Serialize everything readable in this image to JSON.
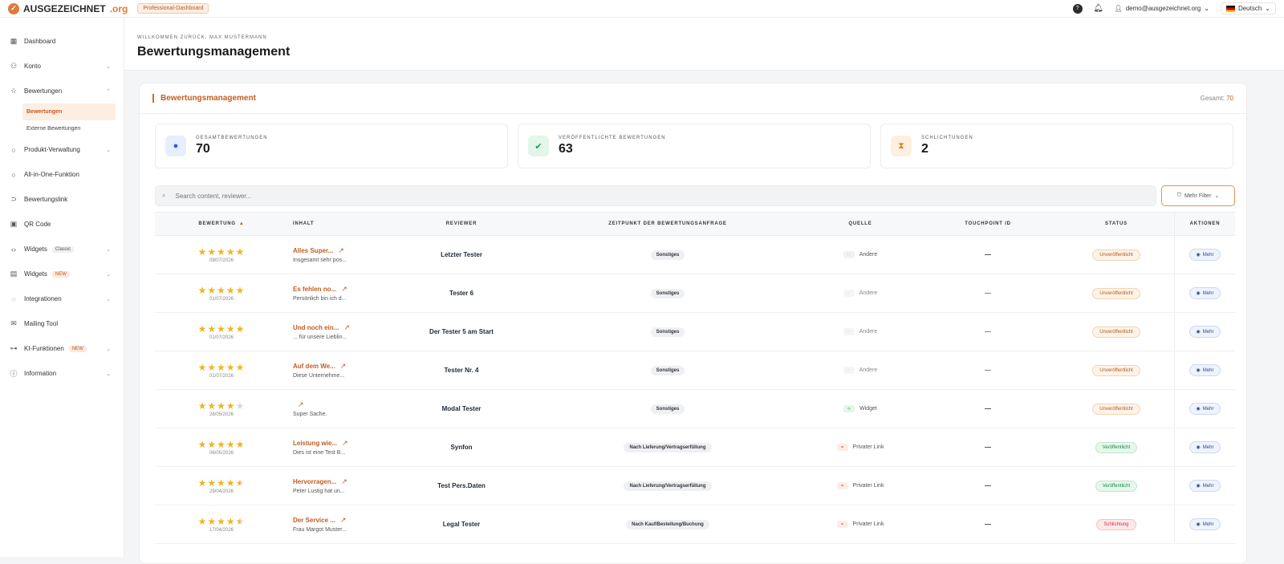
{
  "topbar": {
    "brand": "AUSGEZEICHNET",
    "brand_tld": ".org",
    "plan": "Professional-Dashboard",
    "user_email": "demo@ausgezeichnet.org",
    "language": "Deutsch"
  },
  "sidebar": {
    "items": [
      {
        "label": "Dashboard",
        "icon": "grid-icon"
      },
      {
        "label": "Konto",
        "icon": "user-icon",
        "chevron": true
      },
      {
        "label": "Bewertungen",
        "icon": "star-icon",
        "chevron": true,
        "expanded": true
      },
      {
        "label": "Produkt-Verwaltung",
        "icon": "circle-icon",
        "chevron": true
      },
      {
        "label": "All-in-One-Funktion",
        "icon": "circle-icon"
      },
      {
        "label": "Bewertungslink",
        "icon": "link-icon"
      },
      {
        "label": "QR Code",
        "icon": "qr-icon"
      },
      {
        "label": "Widgets",
        "icon": "code-icon",
        "badge": "Classic",
        "chevron": true
      },
      {
        "label": "Widgets",
        "icon": "widget-icon",
        "badge": "NEW",
        "chevron": true
      },
      {
        "label": "Integrationen",
        "icon": "loader-icon",
        "chevron": true
      },
      {
        "label": "Mailing Tool",
        "icon": "mail-icon"
      },
      {
        "label": "KI-Funktionen",
        "icon": "ai-icon",
        "badge": "NEW",
        "chevron": true
      },
      {
        "label": "Information",
        "icon": "info-icon",
        "chevron": true
      }
    ],
    "sub_items": [
      "Bewertungen",
      "Externe Bewertungen"
    ]
  },
  "header": {
    "welcome": "Willkommen zurück, Max Mustermann",
    "title": "Bewertungsmanagement"
  },
  "card": {
    "title": "Bewertungsmanagement",
    "total_label": "Gesamt:",
    "total_value": "70"
  },
  "stats": [
    {
      "label": "Gesamtbewertungen",
      "value": "70",
      "icon": "chat-bubbles-icon"
    },
    {
      "label": "Veröffentlichte Bewertungen",
      "value": "63",
      "icon": "check-circle-icon"
    },
    {
      "label": "Schlichtungen",
      "value": "2",
      "icon": "hourglass-icon"
    }
  ],
  "filters": {
    "search_placeholder": "Search content, reviewer...",
    "more_filters": "Mehr Filter"
  },
  "table": {
    "headers": [
      "Bewertung",
      "Inhalt",
      "Reviewer",
      "Zeitpunkt der Bewertungsanfrage",
      "Quelle",
      "Touchpoint ID",
      "Status",
      "Aktionen"
    ],
    "more_label": "Mehr",
    "rows": [
      {
        "rating": 5,
        "date": "09/07/2026",
        "title": "Alles Super...",
        "excerpt": "Insgesamt sehr pos...",
        "reviewer": "Letzter Tester",
        "time": "Sonstiges",
        "source": "Andere",
        "touchpoint": "—",
        "status": "Unveröffentlicht",
        "status_type": "unv"
      },
      {
        "rating": 5,
        "date": "01/07/2026",
        "title": "Es fehlen no...",
        "excerpt": "Persönlich bin ich d...",
        "reviewer": "Tester 6",
        "time": "Sonstiges",
        "source": "Andere",
        "touchpoint": "—",
        "status": "Unveröffentlicht",
        "status_type": "unv"
      },
      {
        "rating": 5,
        "date": "01/07/2026",
        "title": "Und noch ein...",
        "excerpt": "... für unsere Lieblin...",
        "reviewer": "Der Tester 5 am Start",
        "time": "Sonstiges",
        "source": "Andere",
        "touchpoint": "—",
        "status": "Unveröffentlicht",
        "status_type": "unv"
      },
      {
        "rating": 5,
        "date": "01/07/2026",
        "title": "Auf dem We...",
        "excerpt": "Diese Unternehme...",
        "reviewer": "Tester Nr. 4",
        "time": "Sonstiges",
        "source": "Andere",
        "touchpoint": "—",
        "status": "Unveröffentlicht",
        "status_type": "unv"
      },
      {
        "rating": 4,
        "date": "26/05/2026",
        "title": "",
        "excerpt": "Super Sache.",
        "reviewer": "Modal Tester",
        "time": "Sonstiges",
        "source": "Widget",
        "touchpoint": "—",
        "status": "Unveröffentlicht",
        "status_type": "unv"
      },
      {
        "rating": 5,
        "date": "06/05/2026",
        "title": "Leistung wie...",
        "excerpt": "Dies ist eine Test B...",
        "reviewer": "Synfon",
        "time": "Nach Lieferung/Vertragserfüllung",
        "source": "Privater Link",
        "touchpoint": "—",
        "status": "Veröffentlicht",
        "status_type": "ver"
      },
      {
        "rating": 4.5,
        "date": "29/04/2026",
        "title": "Hervorragen...",
        "excerpt": "Peter Lustig hat un...",
        "reviewer": "Test Pers.Daten",
        "time": "Nach Lieferung/Vertragserfüllung",
        "source": "Privater Link",
        "touchpoint": "—",
        "status": "Veröffentlicht",
        "status_type": "ver"
      },
      {
        "rating": 4.5,
        "date": "17/04/2026",
        "title": "Der Service ...",
        "excerpt": "Frau Margot Muster...",
        "reviewer": "Legal Tester",
        "time": "Nach Kauf/Bestellung/Buchung",
        "source": "Privater Link",
        "touchpoint": "—",
        "status": "Schlichtung",
        "status_type": "sch"
      }
    ]
  },
  "colors": {
    "accent": "#c25d21",
    "star": "#f2b320"
  }
}
